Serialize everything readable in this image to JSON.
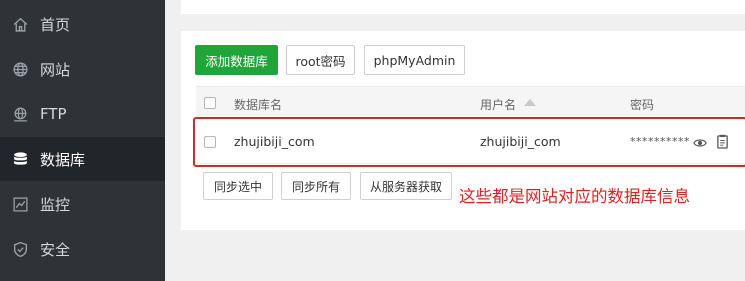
{
  "sidebar": {
    "items": [
      {
        "label": "首页",
        "icon": "home-icon"
      },
      {
        "label": "网站",
        "icon": "globe-icon"
      },
      {
        "label": "FTP",
        "icon": "ftp-icon"
      },
      {
        "label": "数据库",
        "icon": "database-icon",
        "active": true
      },
      {
        "label": "监控",
        "icon": "monitor-icon"
      },
      {
        "label": "安全",
        "icon": "shield-icon"
      }
    ]
  },
  "toolbar": {
    "add_db": "添加数据库",
    "root_password": "root密码",
    "phpmyadmin": "phpMyAdmin"
  },
  "table": {
    "headers": [
      "数据库名",
      "用户名",
      "密码"
    ],
    "rows": [
      {
        "db_name": "zhujibiji_com",
        "username": "zhujibiji_com",
        "password_mask": "**********"
      }
    ]
  },
  "actions": {
    "sync_selected": "同步选中",
    "sync_all": "同步所有",
    "fetch_from_server": "从服务器获取"
  },
  "annotation": "这些都是网站对应的数据库信息",
  "colors": {
    "sidebar_bg": "#2f3337",
    "accent_green": "#20a53a",
    "annotation_red": "#e02020"
  }
}
